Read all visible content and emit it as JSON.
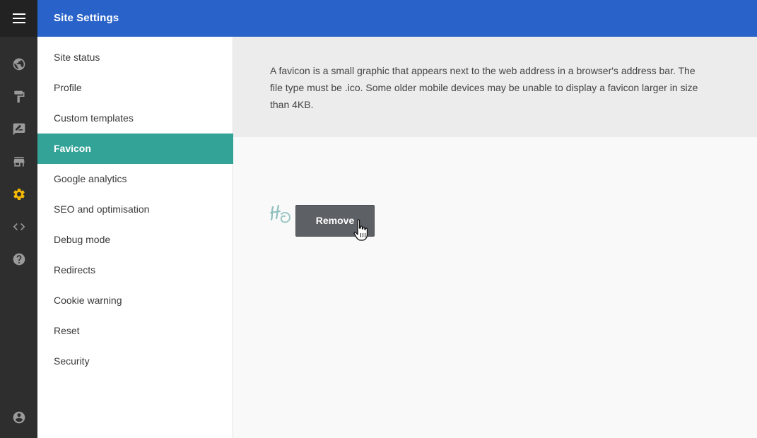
{
  "header": {
    "title": "Site Settings"
  },
  "rail": {
    "icons": [
      "menu-icon",
      "globe-icon",
      "paint-roller-icon",
      "edit-comment-icon",
      "store-icon",
      "gear-icon",
      "code-icon",
      "help-icon",
      "account-icon"
    ],
    "active": "gear-icon",
    "active_color": "#f2b705"
  },
  "menu": {
    "items": [
      {
        "label": "Site status"
      },
      {
        "label": "Profile"
      },
      {
        "label": "Custom templates"
      },
      {
        "label": "Favicon"
      },
      {
        "label": "Google analytics"
      },
      {
        "label": "SEO and optimisation"
      },
      {
        "label": "Debug mode"
      },
      {
        "label": "Redirects"
      },
      {
        "label": "Cookie warning"
      },
      {
        "label": "Reset"
      },
      {
        "label": "Security"
      }
    ],
    "active_index": 3,
    "active_color": "#33a397"
  },
  "main": {
    "description": "A favicon is a small graphic that appears next to the web address in a browser's address bar. The file type must be .ico. Some older mobile devices may be unable to display a favicon larger in size than 4KB.",
    "remove_label": "Remove"
  },
  "colors": {
    "header": "#2962c8",
    "rail": "#2e2e2e"
  }
}
